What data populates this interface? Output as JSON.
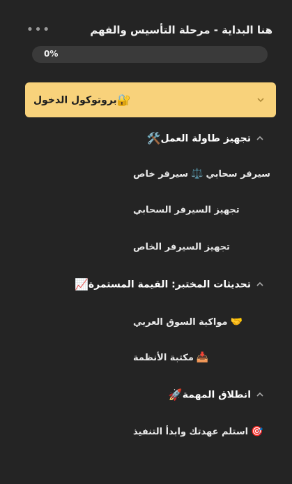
{
  "header": {
    "course_title": "هنا البداية - مرحلة التأسيس والفهم",
    "more_glyph": "•••"
  },
  "progress": {
    "text": "0%",
    "value": 0
  },
  "sections": [
    {
      "label": "بروتوكول الدخول",
      "icon_glyph": "🔐",
      "icon": "lock-key-icon",
      "expanded": false,
      "active": true,
      "lessons": []
    },
    {
      "label": "تجهيز طاولة العمل",
      "icon_glyph": "🛠️",
      "icon": "hammer-wrench-icon",
      "expanded": true,
      "active": false,
      "lessons": [
        {
          "label": "سيرفر خاص",
          "label2": "سيرفر سحابي",
          "icon_glyph": "⚖️",
          "icon": "scale-icon"
        },
        {
          "label": "تجهيز السيرفر السحابي"
        },
        {
          "label": "تجهيز السيرفر الخاص"
        }
      ]
    },
    {
      "label": "تحديثات المختبر: القيمة المستمرة",
      "icon_glyph": "📈",
      "icon": "chart-increasing-icon",
      "expanded": true,
      "active": false,
      "lessons": [
        {
          "label": "مواكبة السوق العربي",
          "icon_glyph": "🤝",
          "icon": "handshake-icon"
        },
        {
          "label": "مكتبة الأنظمة",
          "icon_glyph": "📥",
          "icon": "inbox-tray-icon"
        }
      ]
    },
    {
      "label": "انطلاق المهمة",
      "icon_glyph": "🚀",
      "icon": "rocket-icon",
      "expanded": true,
      "active": false,
      "lessons": [
        {
          "label": "استلم عهدتك وابدأ التنفيذ",
          "icon_glyph": "🎯",
          "icon": "target-icon"
        }
      ]
    }
  ],
  "colors": {
    "background": "#242424",
    "active_section": "#f8d27b",
    "text": "#f2f2f2"
  }
}
